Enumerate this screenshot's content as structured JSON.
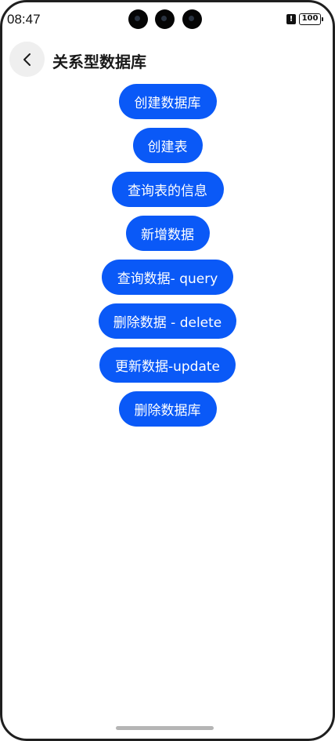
{
  "status_bar": {
    "time": "08:47",
    "battery": "100"
  },
  "header": {
    "title": "关系型数据库",
    "back_icon": "chevron-left-icon"
  },
  "buttons": [
    {
      "label": "创建数据库"
    },
    {
      "label": "创建表"
    },
    {
      "label": "查询表的信息"
    },
    {
      "label": "新增数据"
    },
    {
      "label": "查询数据- query"
    },
    {
      "label": "删除数据 - delete"
    },
    {
      "label": "更新数据-update"
    },
    {
      "label": "删除数据库"
    }
  ],
  "colors": {
    "accent": "#0a59f7",
    "back_button_bg": "#efefef",
    "background": "#ffffff"
  }
}
